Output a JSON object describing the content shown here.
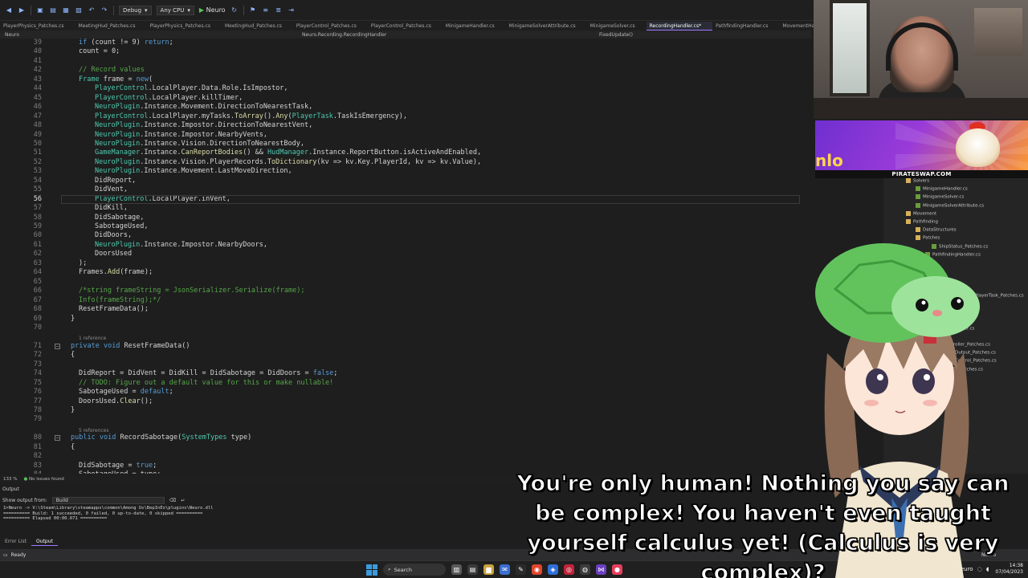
{
  "toolbar": {
    "config": "Debug",
    "platform": "Any CPU",
    "run_target": "Neuro"
  },
  "tabs": [
    "PlayerPhysics_Patches.cs",
    "MeetingHud_Patches.cs",
    "PlayerPhysics_Patches.cs",
    "MeetingHud_Patches.cs",
    "PlayerControl_Patches.cs",
    "PlayerControl_Patches.cs",
    "MinigameHandler.cs",
    "MinigameSolverAttribute.cs",
    "MinigameSolver.cs",
    "RecordingHandler.cs*",
    "PathfindingHandler.cs",
    "MovementHandler.cs"
  ],
  "navbar": {
    "project": "Neuro",
    "class": "Neuro.Recording.RecordingHandler",
    "member": "FixedUpdate()"
  },
  "editor": {
    "line_numbers": [
      "39",
      "40",
      "41",
      "42",
      "43",
      "44",
      "45",
      "46",
      "47",
      "48",
      "49",
      "50",
      "51",
      "52",
      "53",
      "54",
      "55",
      "56",
      "57",
      "58",
      "59",
      "60",
      "61",
      "62",
      "63",
      "64",
      "65",
      "66",
      "67",
      "68",
      "69",
      "70",
      "71",
      "72",
      "73",
      "74",
      "75",
      "76",
      "77",
      "78",
      "79",
      "80",
      "81",
      "82",
      "83",
      "84"
    ],
    "current_line": "56",
    "lines": [
      "if (count != 9) return;",
      "count = 0;",
      "",
      "// Record values",
      "Frame frame = new(",
      "PlayerControl.LocalPlayer.Data.Role.IsImpostor,",
      "PlayerControl.LocalPlayer.killTimer,",
      "NeuroPlugin.Instance.Movement.DirectionToNearestTask,",
      "PlayerControl.LocalPlayer.myTasks.ToArray().Any(PlayerTask.TaskIsEmergency),",
      "NeuroPlugin.Instance.Impostor.DirectionToNearestVent,",
      "NeuroPlugin.Instance.Impostor.NearbyVents,",
      "NeuroPlugin.Instance.Vision.DirectionToNearestBody,",
      "GameManager.Instance.CanReportBodies() && HudManager.Instance.ReportButton.isActiveAndEnabled,",
      "NeuroPlugin.Instance.Vision.PlayerRecords.ToDictionary(kv => kv.Key.PlayerId, kv => kv.Value),",
      "NeuroPlugin.Instance.Movement.LastMoveDirection,",
      "DidReport,",
      "DidVent,",
      "PlayerControl.LocalPlayer.inVent,",
      "DidKill,",
      "DidSabotage,",
      "SabotageUsed,",
      "DidDoors,",
      "NeuroPlugin.Instance.Impostor.NearbyDoors,",
      "DoorsUsed",
      ");",
      "Frames.Add(frame);",
      "",
      "/*string frameString = JsonSerializer.Serialize(frame);",
      "Info(frameString);*/",
      "ResetFrameData();",
      "}",
      "",
      "1 reference",
      "private void ResetFrameData()",
      "{",
      "",
      "DidReport = DidVent = DidKill = DidSabotage = DidDoors = false;",
      "// TODO: Figure out a default value for this or make nullable!",
      "SabotageUsed = default;",
      "DoorsUsed.Clear();",
      "}",
      "",
      "5 references",
      "public void RecordSabotage(SystemTypes type)",
      "{",
      "",
      "DidSabotage = true;",
      "SabotageUsed = type;",
      "}"
    ]
  },
  "editor_status": {
    "zoom": "133 %",
    "issues": "No issues found"
  },
  "output": {
    "panel_title": "Output",
    "show_label": "Show output from:",
    "source": "Build",
    "lines": [
      "1>Neuro -> V:\\Steam\\Library\\steamapps\\common\\Among Us\\BepInEx\\plugins\\Neuro.dll",
      "========== Build: 1 succeeded, 0 failed, 0 up-to-date, 0 skipped ==========",
      "========== Elapsed 00:00.071 =========="
    ]
  },
  "bottom_tabs": [
    "Error List",
    "Output"
  ],
  "statusbar": {
    "state": "Ready",
    "branch": "Neuro"
  },
  "solution_explorer": {
    "items": [
      "Solvers",
      "MinigameHandler.cs",
      "MinigameSolver.cs",
      "MinigameSolverAttribute.cs",
      "Movement",
      "Pathfinding",
      "DataStructures",
      "Patches",
      "ShipStatus_Patches.cs",
      "PathfindingHandler.cs",
      "",
      "",
      "",
      "",
      "alPlayerTask_Patches.cs",
      "",
      "Manager.cs",
      "",
      "tPlayer.cs",
      "",
      "roller_Patches.cs",
      "Output_Patches.cs",
      "Control_Patches.cs",
      "Patches.cs",
      "r.cs"
    ]
  },
  "banner": {
    "caption": "PIRATESWAP.COM",
    "logo_fragment": "nlo"
  },
  "subtitle": "You're only human! Nothing you say can be complex! You haven't even taught yourself calculus yet! (Calculus is very complex)?",
  "taskbar": {
    "search_label": "Search",
    "time": "14:38",
    "date": "07/04/2023",
    "tray_label": "Neuro"
  }
}
